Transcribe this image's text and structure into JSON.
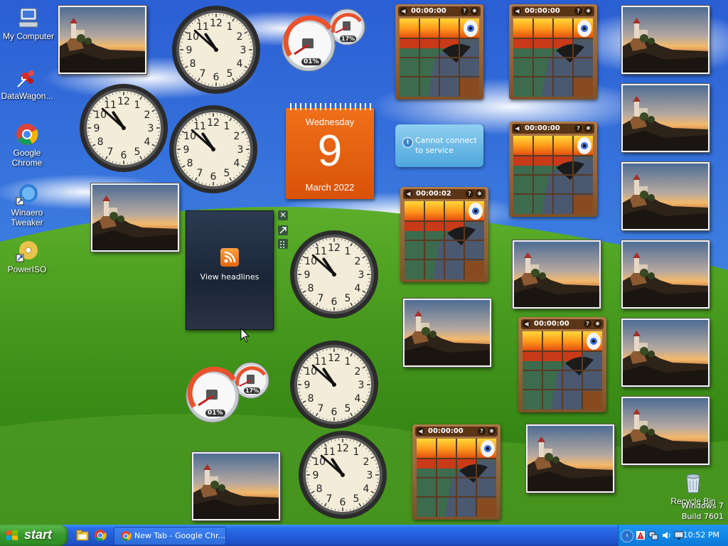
{
  "desktop_icons": [
    {
      "label": "My Computer",
      "icon": "computer-icon"
    },
    {
      "label": "DataWagon...",
      "icon": "datawagon-icon"
    },
    {
      "label": "Google Chrome",
      "icon": "chrome-icon"
    },
    {
      "label": "Winaero Tweaker",
      "icon": "winaero-icon"
    },
    {
      "label": "PowerISO",
      "icon": "poweriso-icon"
    },
    {
      "label": "Recycle Bin",
      "icon": "recycle-bin-icon"
    }
  ],
  "cpu_meters": [
    {
      "cpu": "01%",
      "memory": "17%"
    },
    {
      "cpu": "01%",
      "memory": "17%"
    }
  ],
  "calendar": {
    "weekday": "Wednesday",
    "day": "9",
    "month_year": "March 2022"
  },
  "weather": {
    "message": "Cannot connect to service"
  },
  "feed": {
    "label": "View headlines",
    "close": "✕"
  },
  "puzzles": [
    {
      "timer": "00:00:00"
    },
    {
      "timer": "00:00:00"
    },
    {
      "timer": "00:00:00"
    },
    {
      "timer": "00:00:02"
    },
    {
      "timer": "00:00:00"
    },
    {
      "timer": "00:00:00"
    }
  ],
  "watermark": {
    "line1": "Windows 7",
    "line2": "Build 7601"
  },
  "taskbar": {
    "start_label": "start",
    "task_label": "New Tab - Google Chr...",
    "clock": "10:52 PM"
  },
  "colors": {
    "taskbar": "#245edb",
    "start": "#389a2c",
    "calendar": "#e0600e",
    "tray": "#118ae8"
  }
}
